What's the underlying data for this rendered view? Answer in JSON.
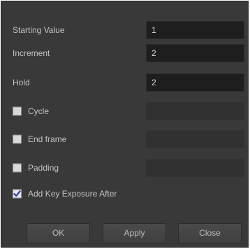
{
  "fields": {
    "starting_value": {
      "label": "Starting Value",
      "value": "1"
    },
    "increment": {
      "label": "Increment",
      "value": "2"
    },
    "hold": {
      "label": "Hold",
      "value": "2"
    }
  },
  "options": {
    "cycle": {
      "label": "Cycle",
      "checked": false,
      "value": ""
    },
    "end_frame": {
      "label": "End frame",
      "checked": false,
      "value": ""
    },
    "padding": {
      "label": "Padding",
      "checked": false,
      "value": ""
    },
    "add_key_exposure_after": {
      "label": "Add Key Exposure After",
      "checked": true
    }
  },
  "buttons": {
    "ok": "OK",
    "apply": "Apply",
    "close": "Close"
  },
  "colors": {
    "dialog_bg": "#393939",
    "field_bg": "#1e1e1e",
    "text": "#c2c2c2"
  }
}
